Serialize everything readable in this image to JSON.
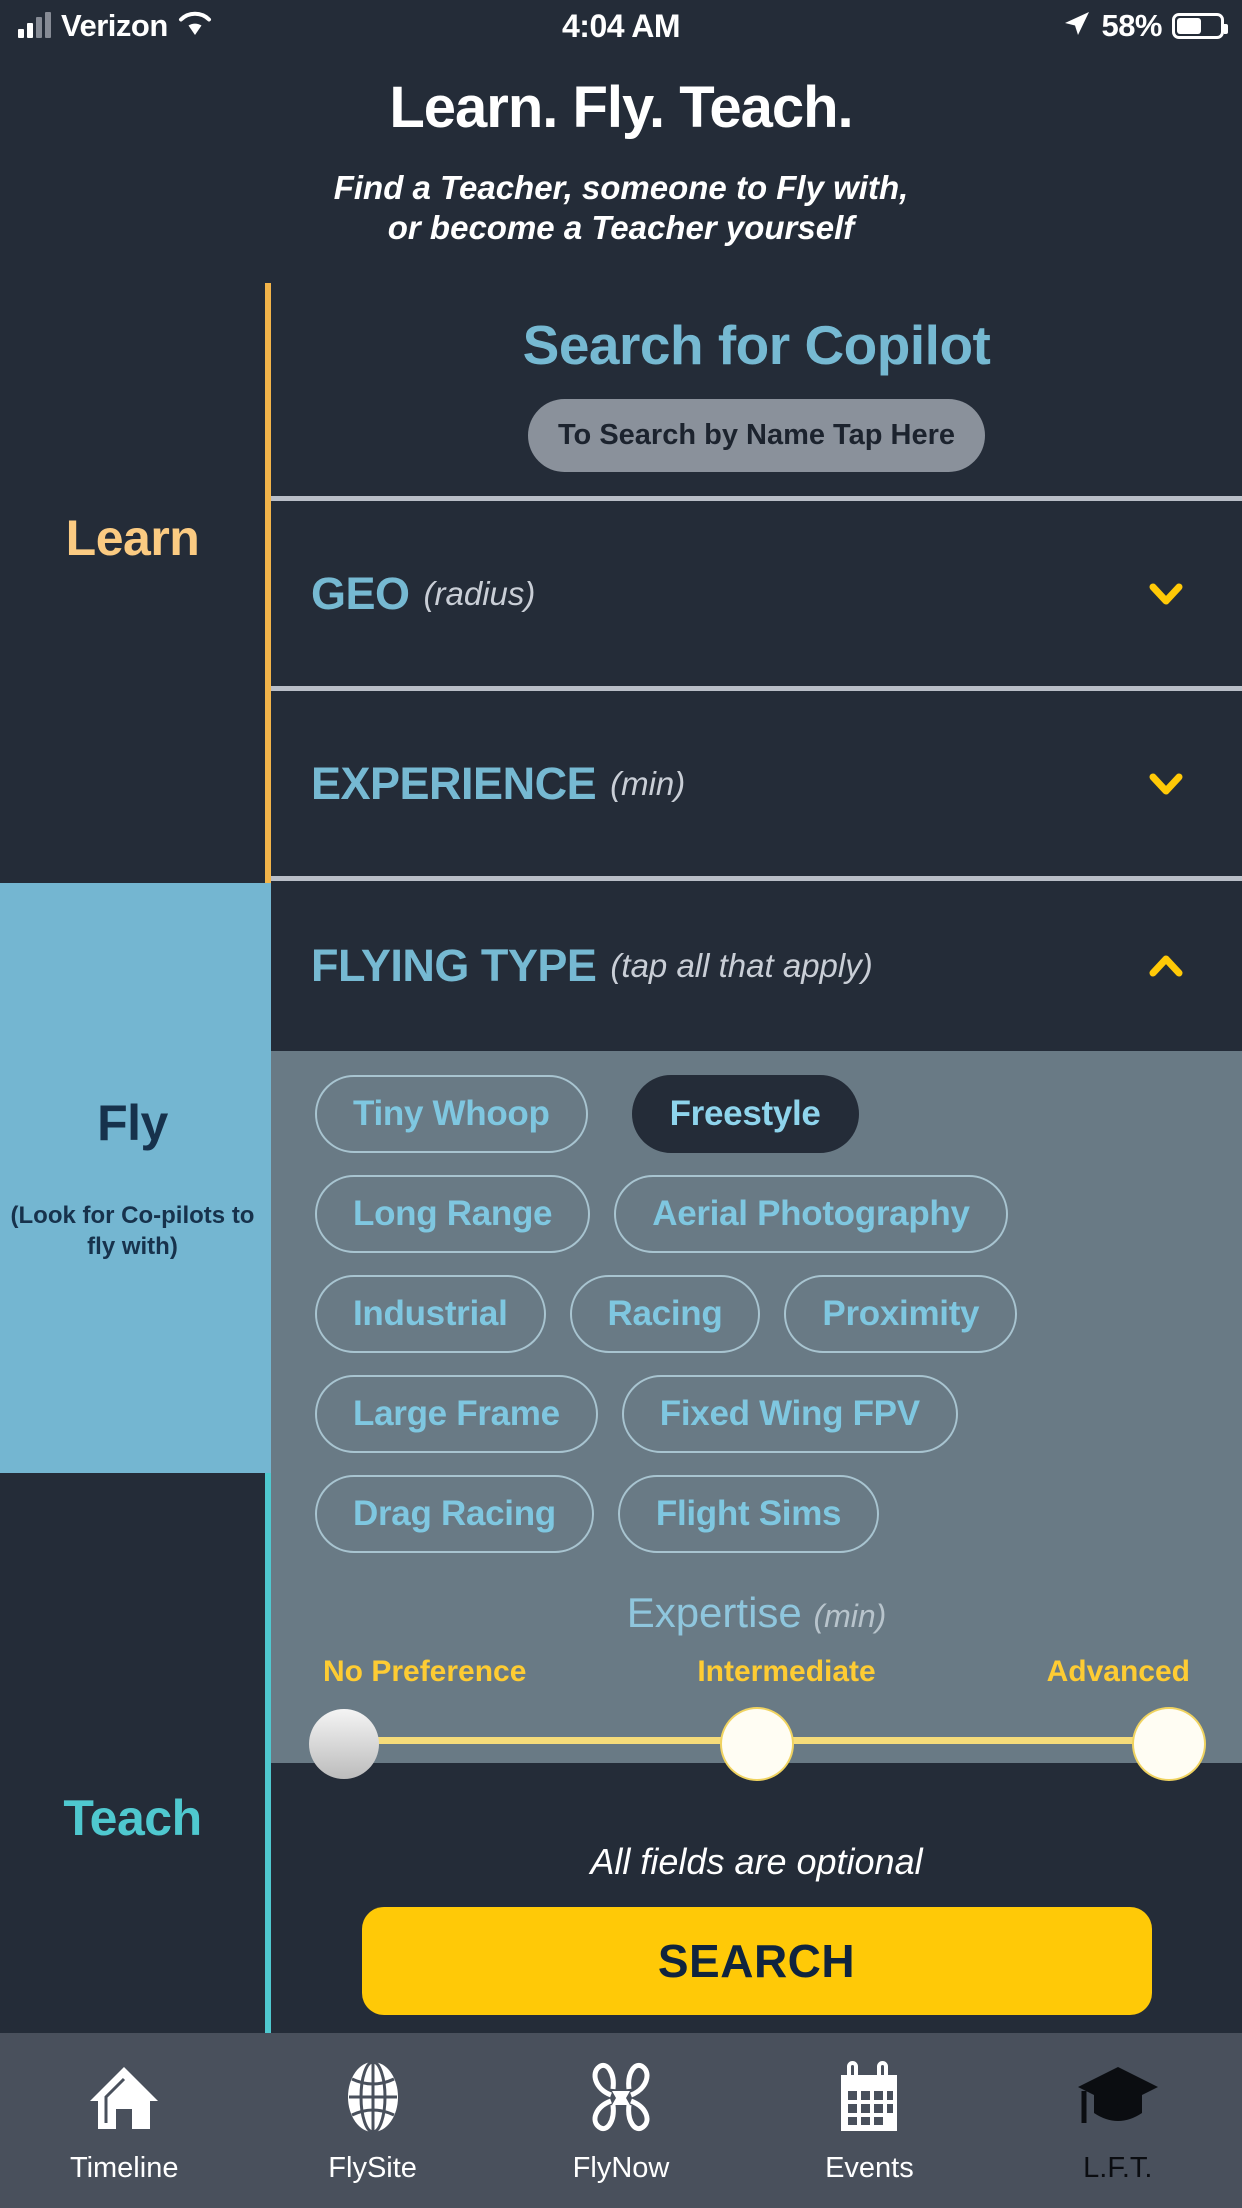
{
  "status_bar": {
    "carrier": "Verizon",
    "time": "4:04 AM",
    "battery_percent": "58%",
    "signal_icon": "cellular-signal-icon",
    "wifi_icon": "wifi-icon",
    "location_icon": "location-arrow-icon",
    "battery_icon": "battery-icon"
  },
  "header": {
    "title": "Learn. Fly. Teach.",
    "subtitle_line1": "Find a Teacher, someone to Fly with,",
    "subtitle_line2": "or become a Teacher yourself"
  },
  "sidebar": {
    "sections": [
      {
        "label": "Learn",
        "note": "",
        "color": "#fbcb82",
        "bg": "#242c38"
      },
      {
        "label": "Fly",
        "note": "(Look for Co-pilots to fly with)",
        "color": "#17324c",
        "bg": "#74b6d1"
      },
      {
        "label": "Teach",
        "note": "",
        "color": "#4fc8cf",
        "bg": "#242c38"
      }
    ]
  },
  "main": {
    "title": "Search for Copilot",
    "name_search_button": "To Search by Name Tap Here",
    "accordions": [
      {
        "title": "GEO",
        "hint": "(radius)",
        "expanded": false,
        "chevron": "chevron-down-icon"
      },
      {
        "title": "EXPERIENCE",
        "hint": "(min)",
        "expanded": false,
        "chevron": "chevron-down-icon"
      },
      {
        "title": "FLYING TYPE",
        "hint": "(tap all that apply)",
        "expanded": true,
        "chevron": "chevron-up-icon"
      }
    ],
    "flying_type_chips": [
      {
        "label": "Tiny Whoop",
        "selected": false
      },
      {
        "label": "Freestyle",
        "selected": true
      },
      {
        "label": "Long Range",
        "selected": false
      },
      {
        "label": "Aerial Photography",
        "selected": false
      },
      {
        "label": "Industrial",
        "selected": false
      },
      {
        "label": "Racing",
        "selected": false
      },
      {
        "label": "Proximity",
        "selected": false
      },
      {
        "label": "Large Frame",
        "selected": false
      },
      {
        "label": "Fixed Wing FPV",
        "selected": false
      },
      {
        "label": "Drag Racing",
        "selected": false
      },
      {
        "label": "Flight Sims",
        "selected": false
      }
    ],
    "expertise": {
      "title": "Expertise",
      "hint": "(min)",
      "labels": [
        "No Preference",
        "Intermediate",
        "Advanced"
      ],
      "selected": "No Preference"
    }
  },
  "footer": {
    "optional_note": "All fields are optional",
    "search_label": "SEARCH"
  },
  "tabbar": {
    "items": [
      {
        "label": "Timeline",
        "icon": "home-icon",
        "active": false
      },
      {
        "label": "FlySite",
        "icon": "globe-icon",
        "active": false
      },
      {
        "label": "FlyNow",
        "icon": "drone-icon",
        "active": false
      },
      {
        "label": "Events",
        "icon": "calendar-icon",
        "active": false
      },
      {
        "label": "L.F.T.",
        "icon": "graduation-cap-icon",
        "active": true
      }
    ]
  },
  "colors": {
    "background": "#242c38",
    "accent_blue": "#76b9d2",
    "accent_yellow": "#ffc907",
    "accent_orange": "#fbcb82",
    "accent_teal": "#4fc8cf",
    "panel_gray": "#697a85"
  }
}
